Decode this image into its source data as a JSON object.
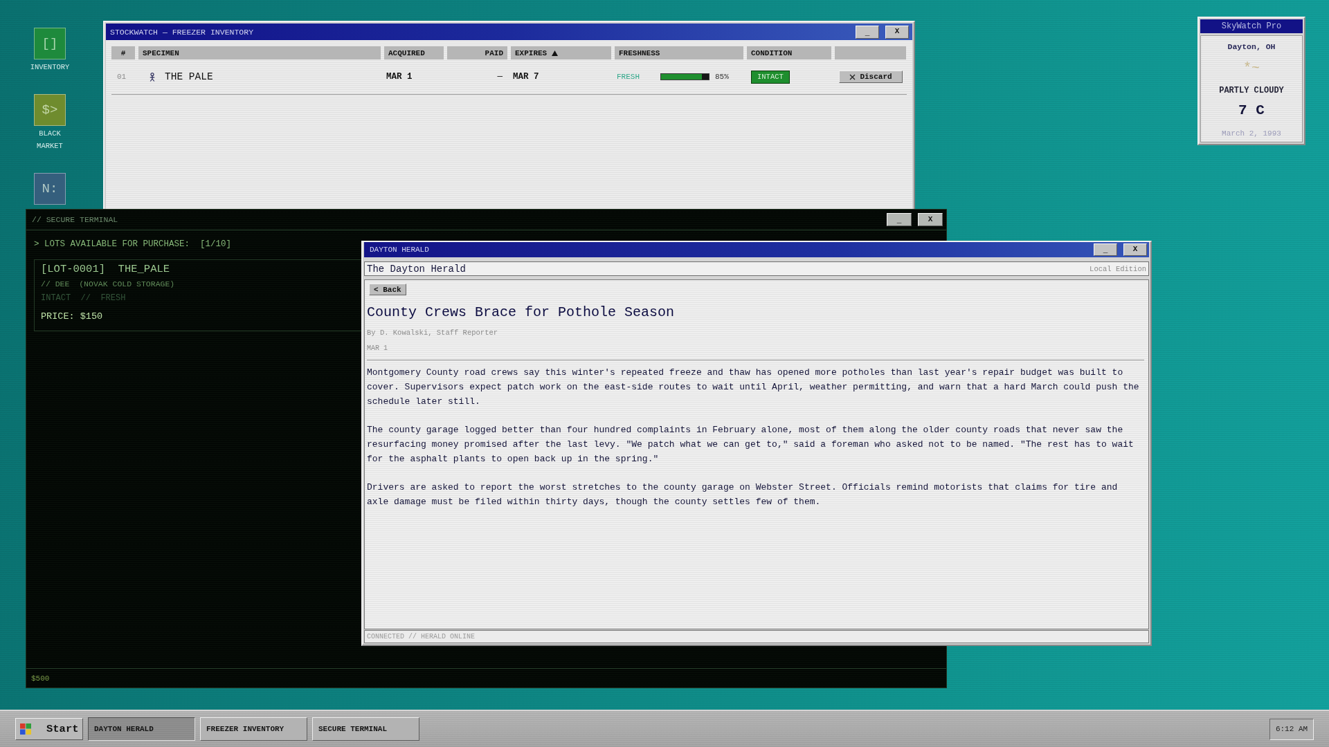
{
  "desktop_icons": [
    {
      "glyph": "[]",
      "label": "INVENTORY",
      "color": "#1e8a3c"
    },
    {
      "glyph": "$>",
      "label": "BLACK MARKET",
      "color": "#6f8c2e"
    },
    {
      "glyph": "N:",
      "color": "#355f7d"
    }
  ],
  "inventory_window": {
    "title": "STOCKWATCH — FREEZER INVENTORY",
    "controls": [
      {
        "kind": "minimize",
        "label": "_"
      },
      {
        "kind": "close",
        "label": "X"
      }
    ],
    "columns": [
      {
        "kind": "text",
        "label": "#",
        "sorted": false
      },
      {
        "kind": "text",
        "label": "SPECIMEN",
        "sorted": false
      },
      {
        "kind": "text",
        "label": "ACQUIRED",
        "sorted": false
      },
      {
        "kind": "text",
        "label": "PAID",
        "sorted": false
      },
      {
        "kind": "text",
        "label": "EXPIRES",
        "sorted": true
      },
      {
        "kind": "text",
        "label": "FRESHNESS",
        "sorted": false
      },
      {
        "kind": "text",
        "label": "CONDITION",
        "sorted": false
      },
      {
        "kind": "blank"
      }
    ],
    "rows": [
      {
        "number": "01",
        "specimen": "THE PALE",
        "acquired": "MAR 1",
        "paid": "—",
        "expires": "MAR 7",
        "freshness": {
          "label": "FRESH",
          "level": 0.85,
          "reading": "85%"
        },
        "condition": {
          "label": "INTACT",
          "color": "#1e8e2e"
        },
        "action": "Discard"
      }
    ]
  },
  "terminal_window": {
    "title": "// SECURE TERMINAL",
    "controls": [
      {
        "kind": "minimize",
        "label": "_"
      },
      {
        "kind": "close",
        "label": "X"
      }
    ],
    "heading": "> LOTS AVAILABLE FOR PURCHASE:  [1/10]",
    "lots": [
      {
        "title": "[LOT-0001]  THE_PALE",
        "source": "// DEE  (NOVAK COLD STORAGE)",
        "status": "INTACT  //  FRESH",
        "price": "PRICE: $150"
      }
    ],
    "footer": "$500"
  },
  "herald_window": {
    "title": "DAYTON HERALD",
    "controls": [
      {
        "kind": "minimize",
        "label": "_"
      },
      {
        "kind": "close",
        "label": "X"
      }
    ],
    "masthead": "The Dayton Herald",
    "edition": "Local Edition",
    "back_button": "< Back",
    "article": {
      "headline": "County Crews Brace for Pothole Season",
      "byline": "By D. Kowalski, Staff Reporter",
      "date": "MAR 1",
      "paragraphs": [
        "Montgomery County road crews say this winter's repeated freeze and thaw has opened more potholes than last year's repair budget was built to cover. Supervisors expect patch work on the east-side routes to wait until April, weather permitting, and warn that a hard March could push the schedule later still.",
        "The county garage logged better than four hundred complaints in February alone, most of them along the older county roads that never saw the resurfacing money promised after the last levy. \"We patch what we can get to,\" said a foreman who asked not to be named. \"The rest has to wait for the asphalt plants to open back up in the spring.\"",
        "Drivers are asked to report the worst stretches to the county garage on Webster Street. Officials remind motorists that claims for tire and axle damage must be filed within thirty days, though the county settles few of them."
      ]
    },
    "status": "CONNECTED // HERALD ONLINE"
  },
  "weather_widget": {
    "title": "SkyWatch Pro",
    "location": "Dayton, OH",
    "symbol": "*~",
    "condition": "PARTLY CLOUDY",
    "temperature": "7 C",
    "date": "March 2, 1993"
  },
  "taskbar": {
    "start": "Start",
    "buttons": [
      {
        "label": "DAYTON HERALD",
        "selected": true
      },
      {
        "label": "FREEZER INVENTORY",
        "selected": false
      },
      {
        "label": "SECURE TERMINAL",
        "selected": false
      }
    ],
    "clock": "6:12 AM"
  }
}
